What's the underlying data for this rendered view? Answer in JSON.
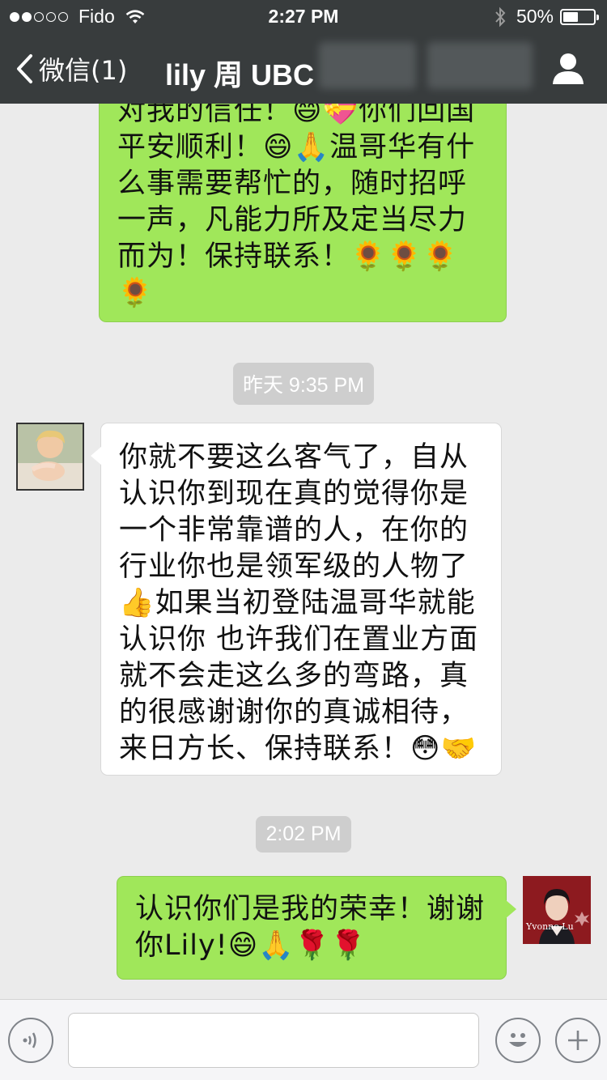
{
  "status_bar": {
    "carrier": "Fido",
    "signal_filled": 2,
    "signal_total": 5,
    "time": "2:27 PM",
    "battery_percent": "50%",
    "battery_level": 0.5
  },
  "nav": {
    "back_label": "微信(1)",
    "title": "lily 周 UBC"
  },
  "messages": [
    {
      "side": "right",
      "lines": [
        "对我的信任！😄💝你们回国",
        "平安顺利！😄🙏温哥华有什",
        "么事需要帮忙的，随时招呼",
        "一声，凡能力所及定当尽力",
        "而为！保持联系！🌻🌻🌻",
        "🌻"
      ]
    },
    {
      "timestamp": "昨天 9:35 PM"
    },
    {
      "side": "left",
      "lines": [
        "你就不要这么客气了，自从",
        "认识你到现在真的觉得你是",
        "一个非常靠谱的人，在你的",
        "行业你也是领军级的人物了",
        "👍如果当初登陆温哥华就能",
        "认识你 也许我们在置业方面",
        "就不会走这么多的弯路，真",
        "的很感谢谢你的真诚相待，",
        "来日方长、保持联系！😳🤝"
      ]
    },
    {
      "timestamp": "2:02 PM"
    },
    {
      "side": "right",
      "lines": [
        "认识你们是我的荣幸！谢谢",
        "你Lily!😄🙏🌹🌹"
      ],
      "avatar_text": "Yvonne Lu"
    }
  ],
  "input": {
    "placeholder": ""
  },
  "colors": {
    "nav_bg": "#383c3d",
    "chat_bg": "#ebebeb",
    "bubble_sent": "#a0e75a",
    "bubble_received": "#ffffff",
    "timestamp_bg": "#cecece"
  }
}
